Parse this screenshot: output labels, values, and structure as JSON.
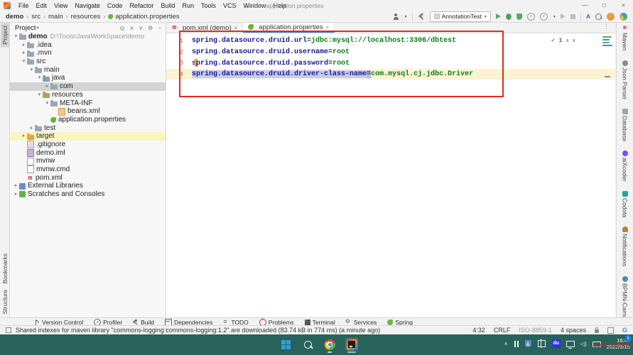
{
  "window": {
    "menu": [
      "File",
      "Edit",
      "View",
      "Navigate",
      "Code",
      "Refactor",
      "Build",
      "Run",
      "Tools",
      "VCS",
      "Window",
      "Help"
    ],
    "title": "demo - application.properties",
    "controls": {
      "minimize": "—",
      "maximize": "□",
      "close": "×"
    }
  },
  "navbar": {
    "breadcrumb": [
      "demo",
      "src",
      "main",
      "resources",
      "application.properties"
    ],
    "run_config": "AnnotationTest"
  },
  "left_stripe": {
    "top": [
      "Project"
    ],
    "bottom": [
      "Bookmarks",
      "Structure"
    ]
  },
  "project_panel": {
    "title": "Project",
    "tree": [
      {
        "label": "demo",
        "suffix": "D:\\Tools\\JavaWorkSpace\\demo",
        "level": 0,
        "chevron": "open",
        "icon": "folder",
        "bold": true
      },
      {
        "label": ".idea",
        "level": 1,
        "chevron": "closed",
        "icon": "folder"
      },
      {
        "label": ".mvn",
        "level": 1,
        "chevron": "closed",
        "icon": "folder"
      },
      {
        "label": "src",
        "level": 1,
        "chevron": "open",
        "icon": "folder"
      },
      {
        "label": "main",
        "level": 2,
        "chevron": "open",
        "icon": "folder"
      },
      {
        "label": "java",
        "level": 3,
        "chevron": "open",
        "icon": "folder-src"
      },
      {
        "label": "com",
        "level": 4,
        "chevron": "closed",
        "icon": "folder",
        "selected": true
      },
      {
        "label": "resources",
        "level": 3,
        "chevron": "open",
        "icon": "folder-res"
      },
      {
        "label": "META-INF",
        "level": 4,
        "chevron": "open",
        "icon": "folder"
      },
      {
        "label": "beans.xml",
        "level": 5,
        "icon": "file-xml"
      },
      {
        "label": "application.properties",
        "level": 4,
        "icon": "file-spring"
      },
      {
        "label": "test",
        "level": 2,
        "chevron": "closed",
        "icon": "folder"
      },
      {
        "label": "target",
        "level": 1,
        "chevron": "closed",
        "icon": "folder-excl",
        "highlight": true
      },
      {
        "label": ".gitignore",
        "level": 1,
        "icon": "file-git"
      },
      {
        "label": "demo.iml",
        "level": 1,
        "icon": "file-iml"
      },
      {
        "label": "mvnw",
        "level": 1,
        "icon": "file-text"
      },
      {
        "label": "mvnw.cmd",
        "level": 1,
        "icon": "file-text"
      },
      {
        "label": "pom.xml",
        "level": 1,
        "icon": "file-maven"
      },
      {
        "label": "External Libraries",
        "level": 0,
        "chevron": "closed",
        "icon": "lib"
      },
      {
        "label": "Scratches and Consoles",
        "level": 0,
        "chevron": "closed",
        "icon": "scratch"
      }
    ]
  },
  "editor": {
    "tabs": [
      {
        "label": "pom.xml (demo)",
        "icon": "maven",
        "active": false,
        "close": "×"
      },
      {
        "label": "application.properties",
        "icon": "spring",
        "active": true,
        "close": "×"
      }
    ],
    "inspections": {
      "check": "✔",
      "ok_count": "1"
    },
    "lines": [
      {
        "num": "1",
        "segs": [
          [
            "key",
            "spring.datasource.druid.url"
          ],
          [
            "eq",
            "="
          ],
          [
            "value",
            "jdbc:mysql://localhost:3306/dbtest"
          ]
        ]
      },
      {
        "num": "2",
        "segs": [
          [
            "key",
            "spring.datasource.druid.username"
          ],
          [
            "eq",
            "="
          ],
          [
            "value",
            "root"
          ]
        ]
      },
      {
        "num": "3",
        "segs": [
          [
            "key",
            "s"
          ],
          [
            "caret",
            ""
          ],
          [
            "key",
            "pring.datasource.druid.password"
          ],
          [
            "eq",
            "="
          ],
          [
            "value",
            "root"
          ]
        ]
      },
      {
        "num": "4",
        "current": true,
        "segs": [
          [
            "key-selected",
            "spring.datasource.druid.driver-class-name"
          ],
          [
            "eq-selected",
            "="
          ],
          [
            "value",
            "com.mysql.cj.jdbc.Driver"
          ]
        ]
      }
    ]
  },
  "right_stripe": [
    {
      "label": "Maven",
      "icon": "maven"
    },
    {
      "label": "Json Parser",
      "icon": "json"
    },
    {
      "label": "Database",
      "icon": "database"
    },
    {
      "label": "aiXcoder",
      "icon": "aixcoder"
    },
    {
      "label": "Codota",
      "icon": "codota"
    },
    {
      "label": "Notifications",
      "icon": "bell"
    },
    {
      "label": "BPMN-Camunda-Diagram",
      "icon": "bpmn"
    }
  ],
  "bottom_bar": [
    {
      "label": "Version Control",
      "icon": "branch"
    },
    {
      "label": "Profiler",
      "icon": "profiler"
    },
    {
      "label": "Build",
      "icon": "hammer"
    },
    {
      "label": "Dependencies",
      "icon": "deps"
    },
    {
      "label": "TODO",
      "icon": "todo"
    },
    {
      "label": "Problems",
      "icon": "problems"
    },
    {
      "label": "Terminal",
      "icon": "terminal"
    },
    {
      "label": "Services",
      "icon": "services"
    },
    {
      "label": "Spring",
      "icon": "spring"
    }
  ],
  "status_bar": {
    "message": "Shared indexes for maven library \"commons-logging:commons-logging:1.2\" are downloaded (83.74 kB in 774 ms) (a minute ago)",
    "caret_position": "4:32",
    "line_separator": "CRLF",
    "encoding": "ISO-8859-1",
    "indent": "4 spaces",
    "g_label": "G"
  },
  "taskbar": {
    "time": "16:49",
    "date": "2022/9/15",
    "du_label": "du",
    "badge_count": "1",
    "watermark": "CSDN @维反特"
  }
}
